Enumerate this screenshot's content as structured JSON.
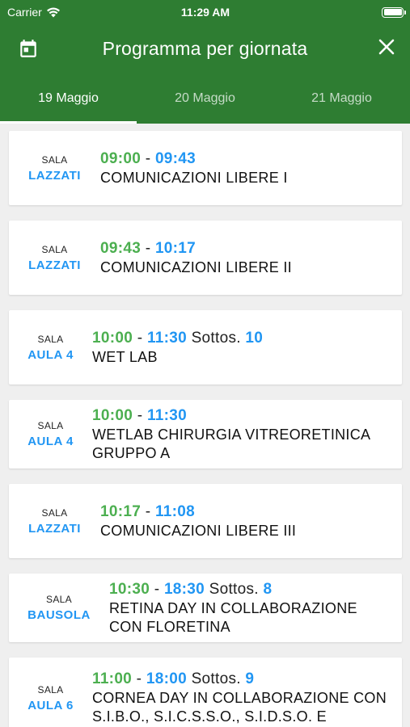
{
  "status_bar": {
    "carrier": "Carrier",
    "time": "11:29 AM"
  },
  "toolbar": {
    "title": "Programma per giornata",
    "calendar_icon": "calendar-icon",
    "close_icon": "close-icon"
  },
  "tabs": [
    {
      "label": "19 Maggio",
      "active": true
    },
    {
      "label": "20 Maggio",
      "active": false
    },
    {
      "label": "21 Maggio",
      "active": false
    }
  ],
  "sessions": [
    {
      "sala": "SALA",
      "room": "LAZZATI",
      "start": "09:00",
      "sep": "-",
      "end": "09:43",
      "sottos_label": "",
      "sottos_num": "",
      "title": "COMUNICAZIONI LIBERE I"
    },
    {
      "sala": "SALA",
      "room": "LAZZATI",
      "start": "09:43",
      "sep": "-",
      "end": "10:17",
      "sottos_label": "",
      "sottos_num": "",
      "title": "COMUNICAZIONI LIBERE II"
    },
    {
      "sala": "SALA",
      "room": "AULA 4",
      "start": "10:00",
      "sep": "-",
      "end": "11:30",
      "sottos_label": "Sottos.",
      "sottos_num": "10",
      "title": "WET LAB"
    },
    {
      "sala": "SALA",
      "room": "AULA 4",
      "start": "10:00",
      "sep": "-",
      "end": "11:30",
      "sottos_label": "",
      "sottos_num": "",
      "title": "WETLAB CHIRURGIA VITREORETINICA GRUPPO A"
    },
    {
      "sala": "SALA",
      "room": "LAZZATI",
      "start": "10:17",
      "sep": "-",
      "end": "11:08",
      "sottos_label": "",
      "sottos_num": "",
      "title": "COMUNICAZIONI LIBERE III"
    },
    {
      "sala": "SALA",
      "room": "BAUSOLA",
      "start": "10:30",
      "sep": "-",
      "end": "18:30",
      "sottos_label": "Sottos.",
      "sottos_num": "8",
      "title": "RETINA DAY IN COLLABORAZIONE CON FLORETINA"
    },
    {
      "sala": "SALA",
      "room": "AULA 6",
      "start": "11:00",
      "sep": "-",
      "end": "18:00",
      "sottos_label": "Sottos.",
      "sottos_num": "9",
      "title": "CORNEA DAY IN COLLABORAZIONE CON S.I.B.O., S.I.C.S.S.O., S.I.D.S.O. E"
    }
  ],
  "colors": {
    "header": "#2e7d32",
    "start_time": "#4caf50",
    "end_time": "#2196f3",
    "room": "#2196f3",
    "background": "#efefef"
  }
}
